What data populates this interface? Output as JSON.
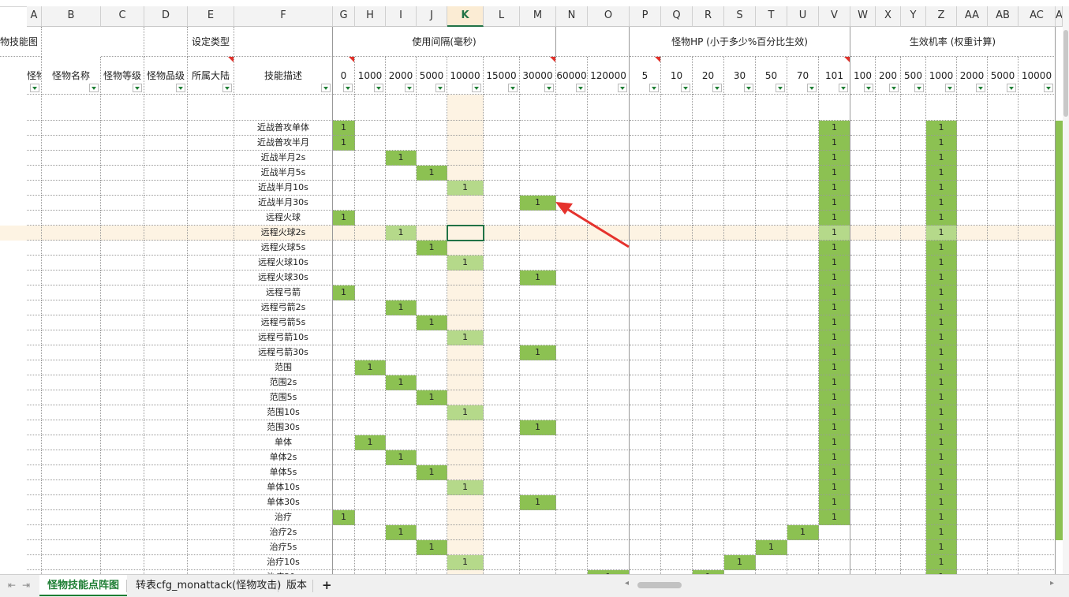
{
  "columns": [
    {
      "letter": "A"
    },
    {
      "letter": "B"
    },
    {
      "letter": "C"
    },
    {
      "letter": "D"
    },
    {
      "letter": "E"
    },
    {
      "letter": "F"
    },
    {
      "letter": "G",
      "header": "0"
    },
    {
      "letter": "H",
      "header": "1000"
    },
    {
      "letter": "I",
      "header": "2000"
    },
    {
      "letter": "J",
      "header": "5000"
    },
    {
      "letter": "K",
      "header": "10000"
    },
    {
      "letter": "L",
      "header": "15000"
    },
    {
      "letter": "M",
      "header": "30000"
    },
    {
      "letter": "N",
      "header": "60000"
    },
    {
      "letter": "O",
      "header": "120000"
    },
    {
      "letter": "P",
      "header": "5"
    },
    {
      "letter": "Q",
      "header": "10"
    },
    {
      "letter": "R",
      "header": "20"
    },
    {
      "letter": "S",
      "header": "30"
    },
    {
      "letter": "T",
      "header": "50"
    },
    {
      "letter": "U",
      "header": "70"
    },
    {
      "letter": "V",
      "header": "101"
    },
    {
      "letter": "W",
      "header": "100"
    },
    {
      "letter": "X",
      "header": "200"
    },
    {
      "letter": "Y",
      "header": "500"
    },
    {
      "letter": "Z",
      "header": "1000"
    },
    {
      "letter": "AA",
      "header": "2000"
    },
    {
      "letter": "AB",
      "header": "5000"
    },
    {
      "letter": "AC",
      "header": "10000"
    },
    {
      "letter": "AD"
    }
  ],
  "selected_column": "K",
  "row1": {
    "a": "物技能图",
    "e": "设定类型",
    "interval_group": "使用间隔(毫秒)",
    "hp_group": "怪物HP (小于多少%百分比生效)",
    "chance_group": "生效机率 (权重计算)"
  },
  "row2": {
    "a": "怪物id",
    "b": "怪物名称",
    "c": "怪物等级",
    "d": "怪物品级",
    "e": "所属大陆",
    "f": "技能描述"
  },
  "cell_value": "1",
  "rows": [
    {
      "desc": "近战普攻单体",
      "ones": [
        "G",
        "V",
        "Z"
      ]
    },
    {
      "desc": "近战普攻半月",
      "ones": [
        "G",
        "V",
        "Z"
      ]
    },
    {
      "desc": "近战半月2s",
      "ones": [
        "I",
        "V",
        "Z"
      ]
    },
    {
      "desc": "近战半月5s",
      "ones": [
        "J",
        "V",
        "Z"
      ]
    },
    {
      "desc": "近战半月10s",
      "ones": [
        "K",
        "V",
        "Z"
      ]
    },
    {
      "desc": "近战半月30s",
      "ones": [
        "M",
        "V",
        "Z"
      ]
    },
    {
      "desc": "远程火球",
      "ones": [
        "G",
        "V",
        "Z"
      ]
    },
    {
      "desc": "远程火球2s",
      "ones": [
        "I",
        "V",
        "Z"
      ],
      "highlight": true
    },
    {
      "desc": "远程火球5s",
      "ones": [
        "J",
        "V",
        "Z"
      ]
    },
    {
      "desc": "远程火球10s",
      "ones": [
        "K",
        "V",
        "Z"
      ]
    },
    {
      "desc": "远程火球30s",
      "ones": [
        "M",
        "V",
        "Z"
      ]
    },
    {
      "desc": "远程弓箭",
      "ones": [
        "G",
        "V",
        "Z"
      ]
    },
    {
      "desc": "远程弓箭2s",
      "ones": [
        "I",
        "V",
        "Z"
      ]
    },
    {
      "desc": "远程弓箭5s",
      "ones": [
        "J",
        "V",
        "Z"
      ]
    },
    {
      "desc": "远程弓箭10s",
      "ones": [
        "K",
        "V",
        "Z"
      ]
    },
    {
      "desc": "远程弓箭30s",
      "ones": [
        "M",
        "V",
        "Z"
      ]
    },
    {
      "desc": "范围",
      "ones": [
        "H",
        "V",
        "Z"
      ]
    },
    {
      "desc": "范围2s",
      "ones": [
        "I",
        "V",
        "Z"
      ]
    },
    {
      "desc": "范围5s",
      "ones": [
        "J",
        "V",
        "Z"
      ]
    },
    {
      "desc": "范围10s",
      "ones": [
        "K",
        "V",
        "Z"
      ]
    },
    {
      "desc": "范围30s",
      "ones": [
        "M",
        "V",
        "Z"
      ]
    },
    {
      "desc": "单体",
      "ones": [
        "H",
        "V",
        "Z"
      ]
    },
    {
      "desc": "单体2s",
      "ones": [
        "I",
        "V",
        "Z"
      ]
    },
    {
      "desc": "单体5s",
      "ones": [
        "J",
        "V",
        "Z"
      ]
    },
    {
      "desc": "单体10s",
      "ones": [
        "K",
        "V",
        "Z"
      ]
    },
    {
      "desc": "单体30s",
      "ones": [
        "M",
        "V",
        "Z"
      ]
    },
    {
      "desc": "治疗",
      "ones": [
        "G",
        "V",
        "Z"
      ]
    },
    {
      "desc": "治疗2s",
      "ones": [
        "I",
        "U",
        "Z"
      ]
    },
    {
      "desc": "治疗5s",
      "ones": [
        "J",
        "T",
        "Z"
      ]
    },
    {
      "desc": "治疗10s",
      "ones": [
        "K",
        "S",
        "Z"
      ]
    },
    {
      "desc": "治疗30s",
      "ones": [
        "O",
        "R",
        "Z"
      ]
    }
  ],
  "ad_green_rows": 28,
  "active_cell": {
    "column": "K",
    "row_index": 7
  },
  "sheet_tabs": [
    {
      "label": "怪物技能点阵图",
      "active": true
    },
    {
      "label": "转表cfg_monattack(怪物攻击)",
      "active": false
    },
    {
      "label": "版本",
      "active": false
    }
  ],
  "add_sheet_label": "+",
  "colors": {
    "green_fill": "#8cc152",
    "green_fill_light": "#b5d98a",
    "highlight": "#fdf3e3",
    "accent": "#217346",
    "arrow": "#e5322d"
  }
}
